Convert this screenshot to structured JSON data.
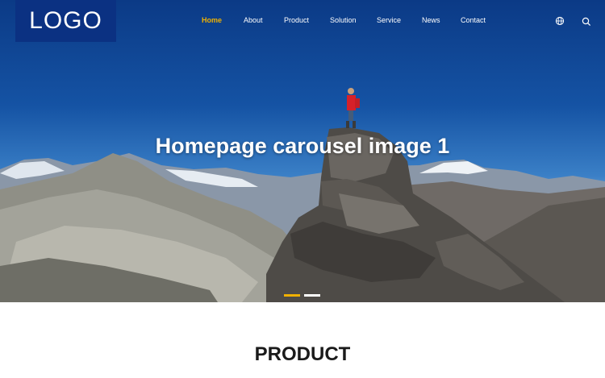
{
  "header": {
    "logo_text": "LOGO",
    "nav": [
      {
        "label": "Home",
        "active": true
      },
      {
        "label": "About",
        "active": false
      },
      {
        "label": "Product",
        "active": false
      },
      {
        "label": "Solution",
        "active": false
      },
      {
        "label": "Service",
        "active": false
      },
      {
        "label": "News",
        "active": false
      },
      {
        "label": "Contact",
        "active": false
      }
    ],
    "icons": [
      "globe-icon",
      "search-icon"
    ],
    "active_color": "#f0b100",
    "logo_bg": "#0b3182"
  },
  "hero": {
    "title": "Homepage carousel image 1",
    "slide_count": 2,
    "active_slide": 1
  },
  "product": {
    "heading": "PRODUCT"
  }
}
